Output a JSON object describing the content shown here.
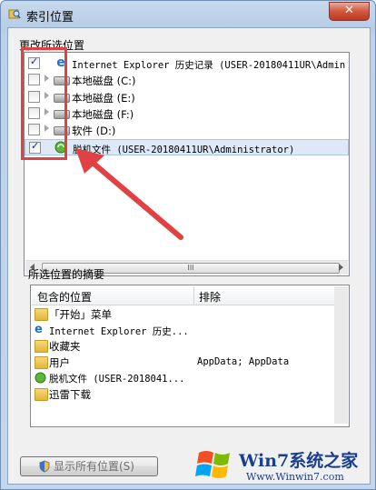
{
  "window": {
    "title": "索引位置",
    "close_label": "✕"
  },
  "change_section": {
    "label": "更改所选位置",
    "rows": [
      {
        "checked": true,
        "expandable": false,
        "icon": "ie-icon",
        "text": "Internet Explorer 历史记录 (USER-20180411UR\\Admin"
      },
      {
        "checked": false,
        "expandable": true,
        "icon": "drive-icon",
        "text": "本地磁盘 (C:)"
      },
      {
        "checked": false,
        "expandable": true,
        "icon": "drive-icon",
        "text": "本地磁盘 (E:)"
      },
      {
        "checked": false,
        "expandable": true,
        "icon": "drive-icon",
        "text": "本地磁盘 (F:)"
      },
      {
        "checked": false,
        "expandable": true,
        "icon": "drive-icon",
        "text": "软件 (D:)"
      },
      {
        "checked": true,
        "expandable": false,
        "icon": "offline-files-icon",
        "text": "脱机文件 (USER-20180411UR\\Administrator)"
      }
    ],
    "scroll_grip": "III"
  },
  "summary_section": {
    "label": "所选位置的摘要",
    "columns": {
      "included": "包含的位置",
      "excluded": "排除"
    },
    "rows": [
      {
        "icon": "folder-icon",
        "text": "「开始」菜单"
      },
      {
        "icon": "ie-icon",
        "text": "Internet Explorer 历史..."
      },
      {
        "icon": "favorites-folder-icon",
        "text": "收藏夹"
      },
      {
        "icon": "user-folder-icon",
        "text": "用户"
      },
      {
        "icon": "offline-files-icon",
        "text": "脱机文件 (USER-2018041..."
      },
      {
        "icon": "folder-icon",
        "text": "迅雷下载"
      }
    ],
    "excluded_text": "AppData; AppData"
  },
  "buttons": {
    "show_all": "显示所有位置(S)"
  },
  "watermark": {
    "brand": "Win7系统之家",
    "url": "Www.Winwin7.com"
  },
  "colors": {
    "annotation": "#e04142",
    "selection": "#dde9f7"
  }
}
